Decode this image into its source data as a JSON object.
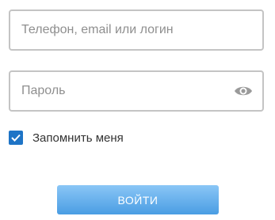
{
  "login_form": {
    "login_field": {
      "placeholder": "Телефон, email или логин",
      "value": ""
    },
    "password_field": {
      "placeholder": "Пароль",
      "value": "",
      "toggle_icon": "eye-icon"
    },
    "remember_me": {
      "label": "Запомнить меня",
      "checked": true
    },
    "submit_label": "ВОЙТИ"
  },
  "colors": {
    "field_border": "#c4c4c4",
    "placeholder": "#8f8f8f",
    "checkbox": "#1e74c6",
    "button_top": "#8ac6f6",
    "button_bottom": "#4a9de3",
    "eye_icon": "#9a9a9a"
  }
}
